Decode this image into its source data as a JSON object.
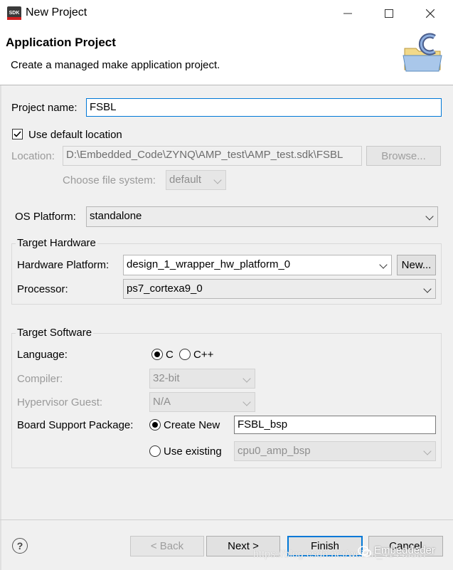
{
  "window": {
    "app_icon_text": "SDK",
    "title": "New Project",
    "minimize_icon": "minimize-icon",
    "maximize_icon": "maximize-icon",
    "close_icon": "close-icon"
  },
  "header": {
    "title": "Application Project",
    "description": "Create a managed make application project.",
    "banner_icon": "folder-c-project-icon"
  },
  "form": {
    "project_name_label": "Project name:",
    "project_name_value": "FSBL",
    "use_default_location_label": "Use default location",
    "use_default_location_checked": true,
    "location_label": "Location:",
    "location_value": "D:\\Embedded_Code\\ZYNQ\\AMP_test\\AMP_test.sdk\\FSBL",
    "browse_label": "Browse...",
    "file_system_label": "Choose file system:",
    "file_system_value": "default",
    "os_platform_label": "OS Platform:",
    "os_platform_value": "standalone"
  },
  "target_hardware": {
    "group_title": "Target Hardware",
    "hw_platform_label": "Hardware Platform:",
    "hw_platform_value": "design_1_wrapper_hw_platform_0",
    "new_button_label": "New...",
    "processor_label": "Processor:",
    "processor_value": "ps7_cortexa9_0"
  },
  "target_software": {
    "group_title": "Target Software",
    "language_label": "Language:",
    "lang_c_label": "C",
    "lang_cpp_label": "C++",
    "selected_language": "C",
    "compiler_label": "Compiler:",
    "compiler_value": "32-bit",
    "hypervisor_label": "Hypervisor Guest:",
    "hypervisor_value": "N/A",
    "bsp_label": "Board Support Package:",
    "create_new_label": "Create New",
    "create_new_value": "FSBL_bsp",
    "use_existing_label": "Use existing",
    "use_existing_value": "cpu0_amp_bsp",
    "selected_bsp": "Create New"
  },
  "footer": {
    "help_icon_text": "?",
    "back_label": "< Back",
    "next_label": "Next >",
    "finish_label": "Finish",
    "cancel_label": "Cancel"
  },
  "watermark": {
    "url_text": "https://blog.csdn.net/weixin_41445387",
    "brand_text": "Embeddeder"
  }
}
